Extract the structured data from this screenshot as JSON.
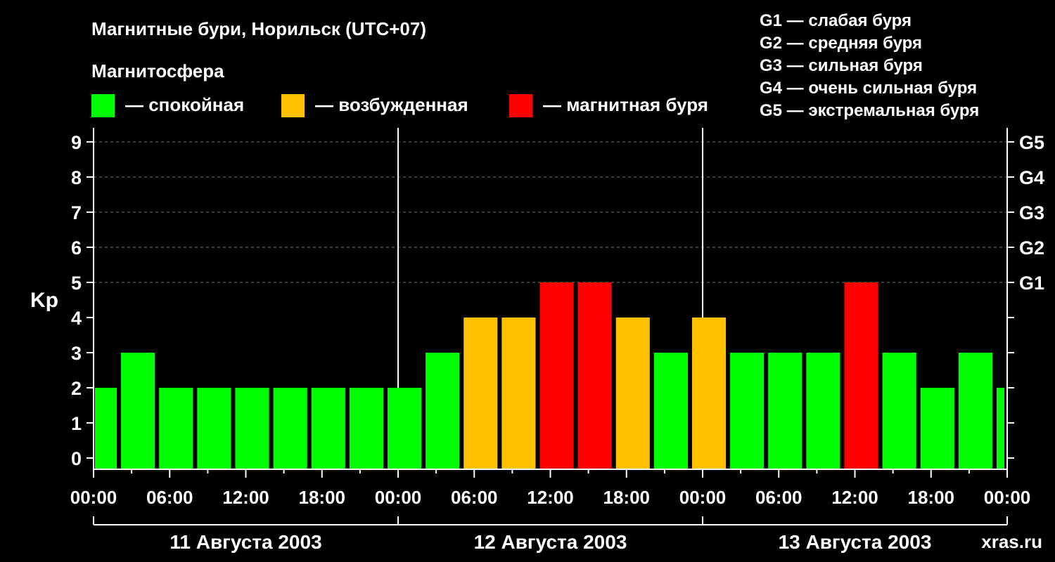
{
  "colors": {
    "background": "#000000",
    "calm": "#00ff00",
    "disturbed": "#ffc000",
    "storm": "#ff0000",
    "axis": "#ffffff",
    "grid": "#808080",
    "watermark": "#808080"
  },
  "watermark": "xras.ru",
  "chart_data": {
    "type": "bar",
    "title": "Магнитные бури, Норильск (UTC+07)",
    "legend_title": "Магнитосфера",
    "legend": [
      {
        "label": "— спокойная",
        "color_key": "calm"
      },
      {
        "label": "— возбужденная",
        "color_key": "disturbed"
      },
      {
        "label": "— магнитная буря",
        "color_key": "storm"
      }
    ],
    "g_scale": [
      "G1 — слабая буря",
      "G2 — средняя буря",
      "G3 — сильная буря",
      "G4 — очень сильная буря",
      "G5 — экстремальная буря"
    ],
    "ylabel": "Kp",
    "ylim": [
      0,
      9
    ],
    "y_ticks": [
      "0",
      "1",
      "2",
      "3",
      "4",
      "5",
      "6",
      "7",
      "8",
      "9"
    ],
    "right_ticks": [
      {
        "value": 5,
        "label": "G1"
      },
      {
        "value": 6,
        "label": "G2"
      },
      {
        "value": 7,
        "label": "G3"
      },
      {
        "value": 8,
        "label": "G4"
      },
      {
        "value": 9,
        "label": "G5"
      }
    ],
    "x_tick_labels": [
      "00:00",
      "06:00",
      "12:00",
      "18:00",
      "00:00",
      "06:00",
      "12:00",
      "18:00",
      "00:00",
      "06:00",
      "12:00",
      "18:00",
      "00:00"
    ],
    "days": [
      "11 Августа 2003",
      "12 Августа 2003",
      "13 Августа 2003"
    ],
    "bar_interval_hours": 3,
    "bar_start_hours": [
      -1,
      2,
      5,
      8,
      11,
      14,
      17,
      20,
      23,
      26,
      29,
      32,
      35,
      38,
      41,
      44,
      47,
      50,
      53,
      56,
      59,
      62,
      65,
      68,
      71
    ],
    "values": [
      2,
      3,
      2,
      2,
      2,
      2,
      2,
      2,
      2,
      3,
      4,
      4,
      5,
      5,
      4,
      3,
      4,
      3,
      3,
      3,
      5,
      3,
      2,
      3,
      2
    ],
    "levels": [
      "calm",
      "calm",
      "calm",
      "calm",
      "calm",
      "calm",
      "calm",
      "calm",
      "calm",
      "calm",
      "disturbed",
      "disturbed",
      "storm",
      "storm",
      "disturbed",
      "calm",
      "disturbed",
      "calm",
      "calm",
      "calm",
      "storm",
      "calm",
      "calm",
      "calm",
      "calm"
    ],
    "x_range_hours": [
      0,
      72
    ],
    "grid": "dashed horizontal at integer Kp 6–9, solid day separators"
  }
}
